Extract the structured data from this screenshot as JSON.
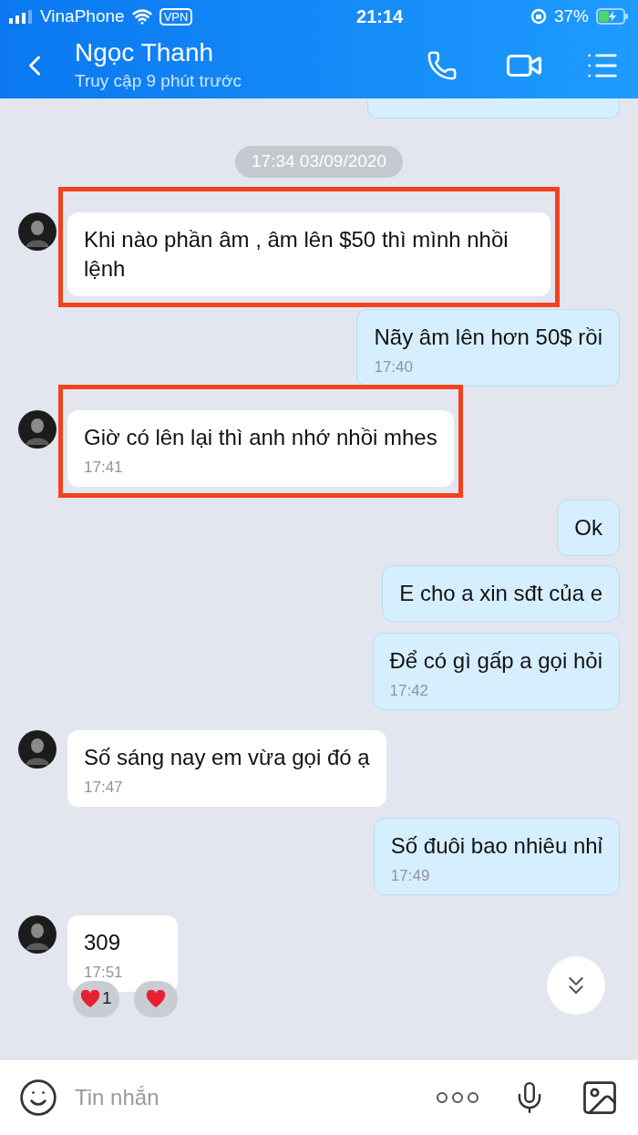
{
  "status_bar": {
    "carrier": "VinaPhone",
    "vpn": "VPN",
    "time": "21:14",
    "battery": "37%"
  },
  "header": {
    "name": "Ngọc Thanh",
    "subtitle": "Truy cập 9 phút trước"
  },
  "date_divider": "17:34 03/09/2020",
  "messages": [
    {
      "kind": "incoming",
      "text": "Khi nào phần âm , âm lên $50 thì mình nhồi lệnh",
      "highlighted": true
    },
    {
      "kind": "outgoing",
      "text": "Nãy âm lên hơn 50$ rồi",
      "time": "17:40",
      "highlighted": false
    },
    {
      "kind": "incoming",
      "text": "Giờ có lên lại thì anh nhớ nhồi mhes",
      "time": "17:41",
      "highlighted": true
    },
    {
      "kind": "outgoing",
      "text": "Ok",
      "highlighted": false
    },
    {
      "kind": "outgoing",
      "text": "E cho a xin sđt của e",
      "highlighted": false
    },
    {
      "kind": "outgoing",
      "text": "Để có gì gấp a gọi hỏi",
      "time": "17:42",
      "highlighted": false
    },
    {
      "kind": "incoming",
      "text": "Số sáng nay em vừa gọi đó ạ",
      "time": "17:47",
      "highlighted": false
    },
    {
      "kind": "outgoing",
      "text": "Số đuôi bao nhiêu nhỉ",
      "time": "17:49",
      "highlighted": false
    },
    {
      "kind": "incoming",
      "text": "309",
      "time": "17:51",
      "highlighted": false,
      "reaction_count": "1"
    }
  ],
  "composer": {
    "placeholder": "Tin nhắn"
  }
}
